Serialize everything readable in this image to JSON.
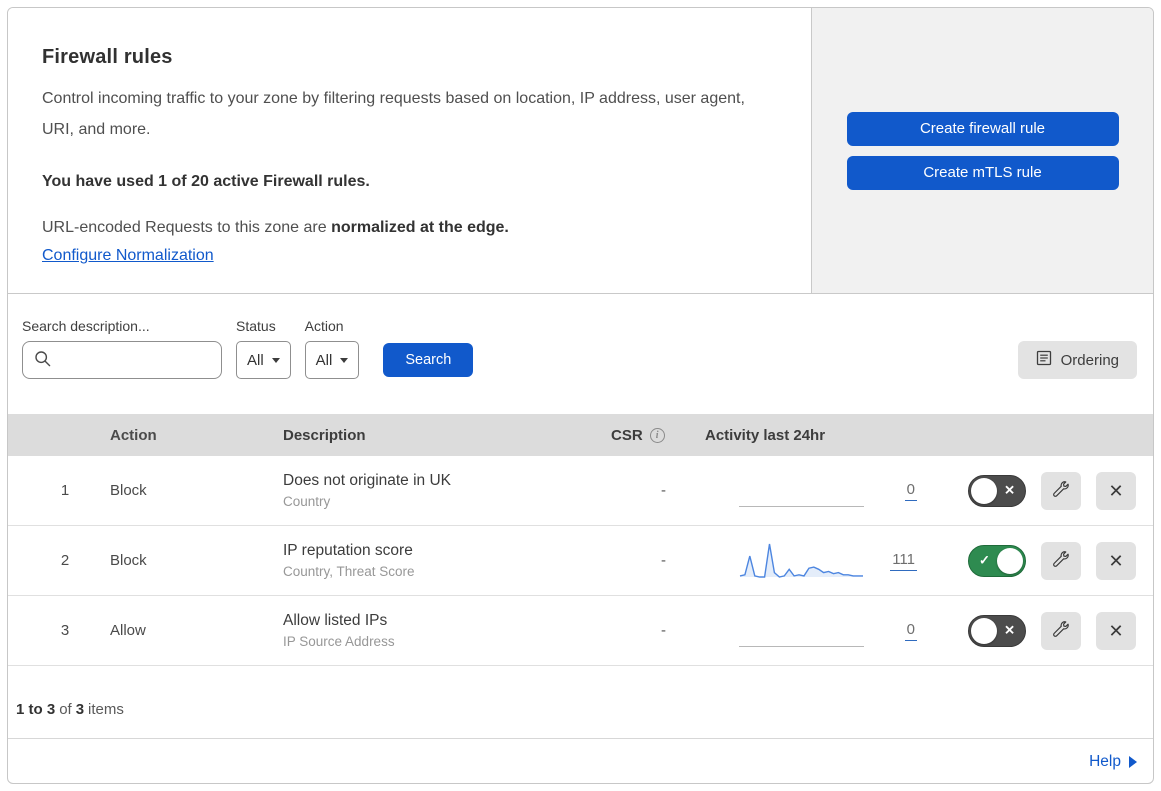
{
  "header": {
    "title": "Firewall rules",
    "description": "Control incoming traffic to your zone by filtering requests based on location, IP address, user agent, URI, and more.",
    "usage_line": "You have used 1 of 20 active Firewall rules.",
    "normalization_prefix": "URL-encoded Requests to this zone are ",
    "normalization_bold": "normalized at the edge.",
    "normalization_link": "Configure Normalization"
  },
  "actions_panel": {
    "create_firewall_label": "Create firewall rule",
    "create_mtls_label": "Create mTLS rule"
  },
  "filters": {
    "search_label": "Search description...",
    "search_value": "",
    "status_label": "Status",
    "status_value": "All",
    "action_label": "Action",
    "action_value": "All",
    "search_button": "Search",
    "ordering_button": "Ordering"
  },
  "table": {
    "columns": {
      "action": "Action",
      "description": "Description",
      "csr": "CSR",
      "activity": "Activity last 24hr"
    },
    "rows": [
      {
        "num": "1",
        "action": "Block",
        "description": "Does not originate in UK",
        "fields": "Country",
        "csr": "-",
        "activity_count": "0",
        "enabled": false,
        "has_sparkline": false
      },
      {
        "num": "2",
        "action": "Block",
        "description": "IP reputation score",
        "fields": "Country, Threat Score",
        "csr": "-",
        "activity_count": "111",
        "enabled": true,
        "has_sparkline": true
      },
      {
        "num": "3",
        "action": "Allow",
        "description": "Allow listed IPs",
        "fields": "IP Source Address",
        "csr": "-",
        "activity_count": "0",
        "enabled": false,
        "has_sparkline": false
      }
    ]
  },
  "footer": {
    "range_bold": "1 to 3",
    "of_text": "of",
    "total_bold": "3",
    "items_text": "items",
    "help_label": "Help"
  },
  "chart_data": {
    "type": "area",
    "title": "Activity last 24hr sparkline (rule 2)",
    "total_label": "111",
    "values": [
      1,
      2,
      19,
      1,
      0,
      0,
      30,
      4,
      0,
      1,
      7,
      1,
      2,
      1,
      8,
      9,
      7,
      4,
      5,
      3,
      4,
      2,
      2,
      1,
      1,
      1
    ],
    "axes": "none",
    "line_color": "#4d86e0",
    "fill_color": "rgba(77,134,224,0.15)"
  },
  "colors": {
    "primary_blue": "#1159cb",
    "toggle_on_green": "#2e8b50",
    "toggle_off_gray": "#4c4c4c",
    "sparkline_blue": "#4d86e0",
    "panel_gray": "#f1f1f1",
    "table_header_gray": "#dcdcdc"
  }
}
